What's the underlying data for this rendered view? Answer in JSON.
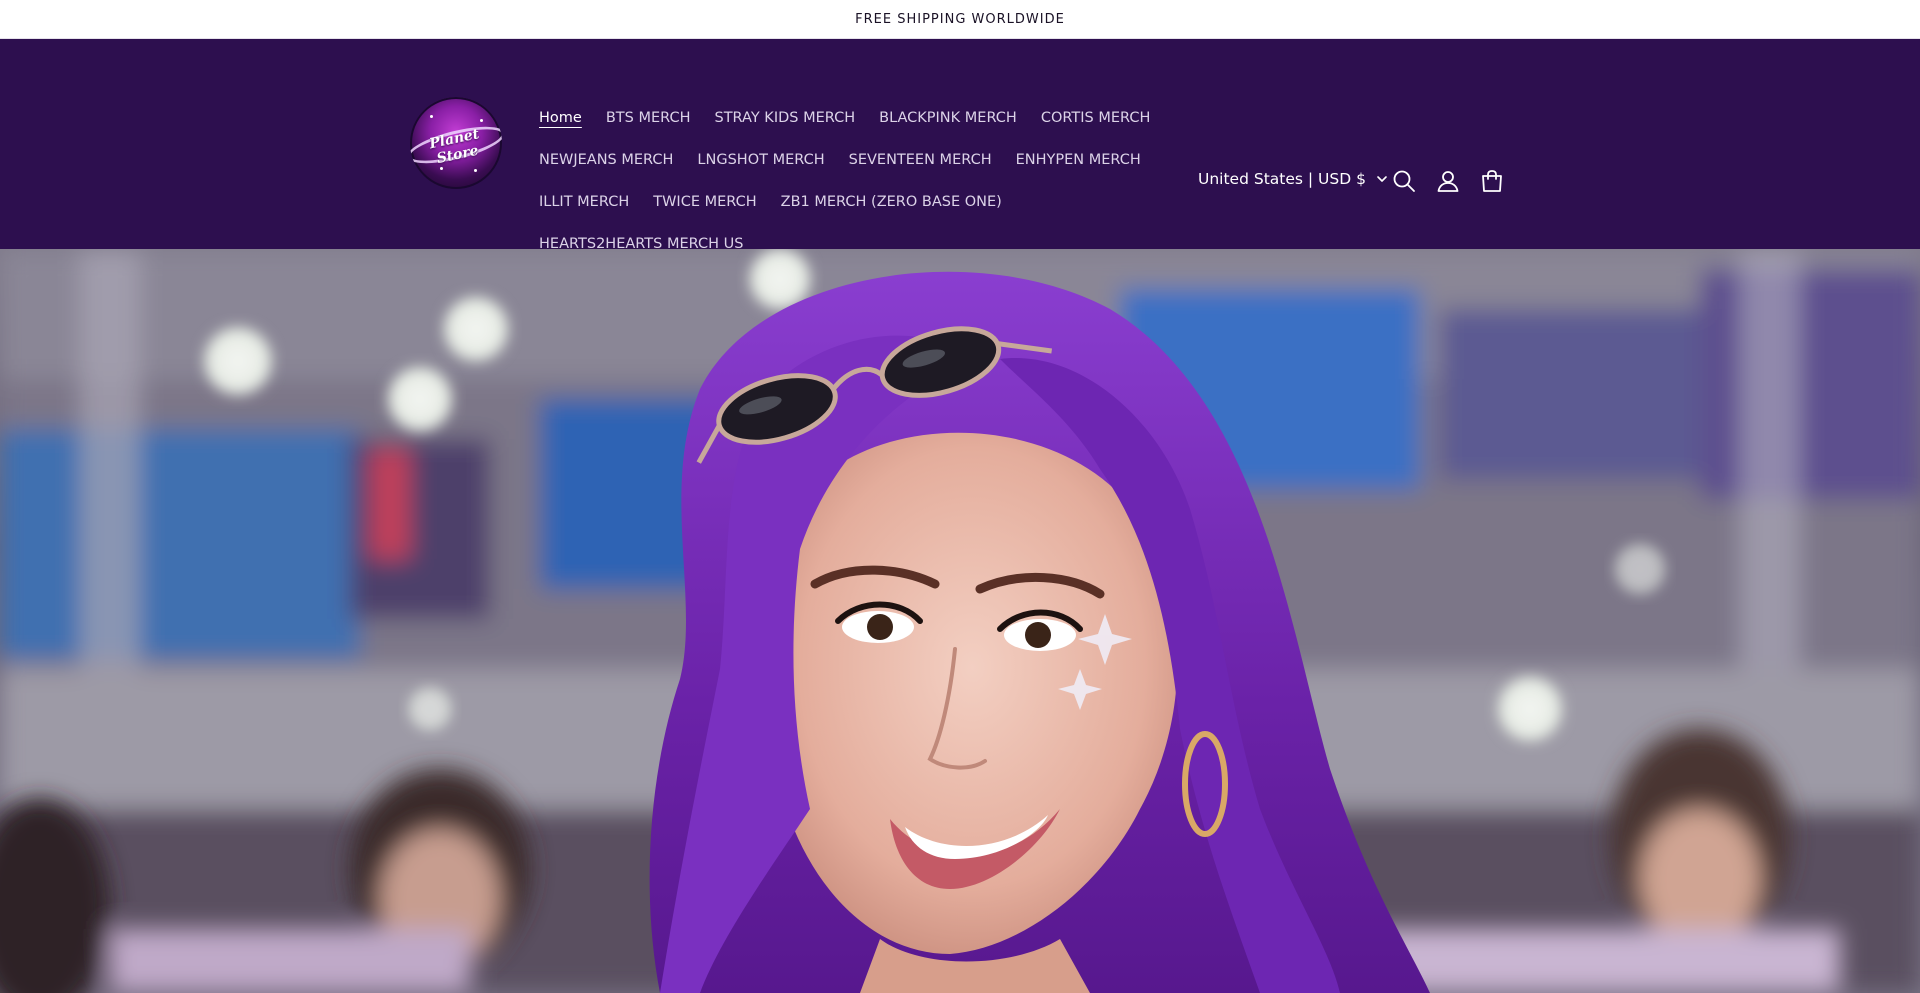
{
  "announcement": {
    "text": "FREE SHIPPING WORLDWIDE"
  },
  "brand": {
    "name": "Planet Store"
  },
  "nav": {
    "rows": [
      [
        {
          "label": "Home",
          "active": true
        },
        {
          "label": "BTS MERCH"
        },
        {
          "label": "STRAY KIDS MERCH"
        },
        {
          "label": "BLACKPINK MERCH"
        },
        {
          "label": "CORTIS MERCH"
        }
      ],
      [
        {
          "label": "NEWJEANS MERCH"
        },
        {
          "label": "LNGSHOT MERCH"
        },
        {
          "label": "SEVENTEEN MERCH"
        },
        {
          "label": "ENHYPEN MERCH"
        }
      ],
      [
        {
          "label": "ILLIT MERCH"
        },
        {
          "label": "TWICE MERCH"
        },
        {
          "label": "ZB1 MERCH (ZERO BASE ONE)"
        }
      ],
      [
        {
          "label": "HEARTS2HEARTS MERCH US"
        }
      ]
    ]
  },
  "localization": {
    "label": "United States | USD $"
  },
  "icons": {
    "country_chevron": "chevron-down-icon",
    "search": "search-icon",
    "account": "account-icon",
    "cart": "cart-icon"
  },
  "colors": {
    "header_bg": "#2d0f4f",
    "announcement_bg": "#ffffff",
    "nav_text": "#dcd3e8",
    "accent_hair": "#7a2fc0"
  }
}
